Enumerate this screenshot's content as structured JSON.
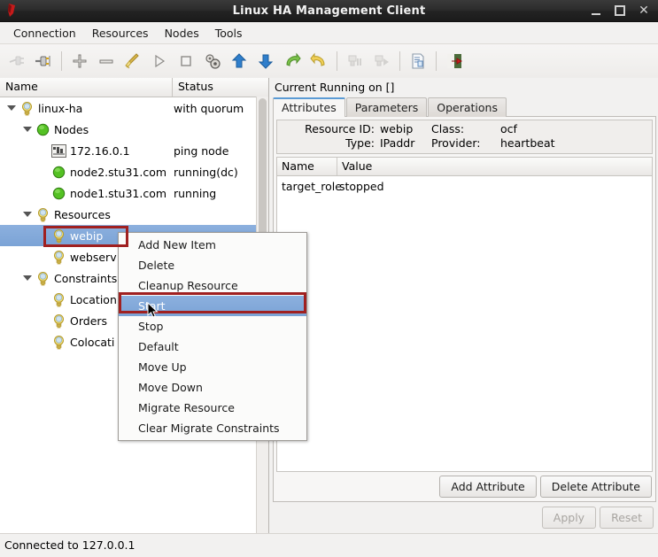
{
  "window": {
    "title": "Linux HA Management Client",
    "app_icon": "app-logo-icon",
    "minimize": "–",
    "maximize": "□",
    "close": "✕"
  },
  "menubar": {
    "items": [
      {
        "label": "Connection"
      },
      {
        "label": "Resources"
      },
      {
        "label": "Nodes"
      },
      {
        "label": "Tools"
      }
    ]
  },
  "toolbar": {
    "items": [
      {
        "name": "connect-icon",
        "enabled": false
      },
      {
        "name": "disconnect-icon",
        "enabled": true
      },
      {
        "name": "add-icon",
        "enabled": true
      },
      {
        "name": "remove-icon",
        "enabled": true
      },
      {
        "name": "cleanup-broom-icon",
        "enabled": true
      },
      {
        "name": "start-play-icon",
        "enabled": true
      },
      {
        "name": "stop-square-icon",
        "enabled": true
      },
      {
        "name": "default-gears-icon",
        "enabled": true
      },
      {
        "name": "move-up-arrow-icon",
        "enabled": true
      },
      {
        "name": "move-down-arrow-icon",
        "enabled": true
      },
      {
        "name": "migrate-resource-icon",
        "enabled": true
      },
      {
        "name": "clear-migrate-constraints-icon",
        "enabled": true
      },
      {
        "name": "standby-node-icon",
        "enabled": false
      },
      {
        "name": "activate-node-icon",
        "enabled": false
      },
      {
        "name": "cib-document-icon",
        "enabled": true
      },
      {
        "name": "exit-icon",
        "enabled": true
      }
    ]
  },
  "tree": {
    "columns": {
      "name": "Name",
      "status": "Status"
    },
    "rows": [
      {
        "label": "linux-ha",
        "status": "with quorum",
        "indent": 0,
        "icon": "bulb-icon",
        "twisty": "expanded",
        "selected": false
      },
      {
        "label": "Nodes",
        "status": "",
        "indent": 1,
        "icon": "green-circle-icon",
        "twisty": "expanded",
        "selected": false
      },
      {
        "label": "172.16.0.1",
        "status": "ping node",
        "indent": 2,
        "icon": "ping-node-icon",
        "twisty": "none",
        "selected": false
      },
      {
        "label": "node2.stu31.com",
        "status": "running(dc)",
        "indent": 2,
        "icon": "green-circle-icon",
        "twisty": "none",
        "selected": false
      },
      {
        "label": "node1.stu31.com",
        "status": "running",
        "indent": 2,
        "icon": "green-circle-icon",
        "twisty": "none",
        "selected": false
      },
      {
        "label": "Resources",
        "status": "",
        "indent": 1,
        "icon": "bulb-icon",
        "twisty": "expanded",
        "selected": false
      },
      {
        "label": "webip",
        "status": "",
        "indent": 2,
        "icon": "bulb-icon",
        "twisty": "none",
        "selected": true
      },
      {
        "label": "webserv",
        "status": "",
        "indent": 2,
        "icon": "bulb-icon",
        "twisty": "none",
        "selected": false
      },
      {
        "label": "Constraints",
        "status": "",
        "indent": 1,
        "icon": "bulb-icon",
        "twisty": "expanded",
        "selected": false
      },
      {
        "label": "Location",
        "status": "",
        "indent": 2,
        "icon": "bulb-icon",
        "twisty": "none",
        "selected": false
      },
      {
        "label": "Orders",
        "status": "",
        "indent": 2,
        "icon": "bulb-icon",
        "twisty": "none",
        "selected": false
      },
      {
        "label": "Colocati",
        "status": "",
        "indent": 2,
        "icon": "bulb-icon",
        "twisty": "none",
        "selected": false
      }
    ]
  },
  "context_menu": {
    "items": [
      {
        "label": "Add New Item",
        "highlighted": false
      },
      {
        "label": "Delete",
        "highlighted": false
      },
      {
        "label": "Cleanup Resource",
        "highlighted": false
      },
      {
        "label": "Start",
        "highlighted": true
      },
      {
        "label": "Stop",
        "highlighted": false
      },
      {
        "label": "Default",
        "highlighted": false
      },
      {
        "label": "Move Up",
        "highlighted": false
      },
      {
        "label": "Move Down",
        "highlighted": false
      },
      {
        "label": "Migrate Resource",
        "highlighted": false
      },
      {
        "label": "Clear Migrate Constraints",
        "highlighted": false
      }
    ]
  },
  "right_panel": {
    "running_label": "Current Running on []",
    "tabs": [
      {
        "label": "Attributes",
        "active": true
      },
      {
        "label": "Parameters",
        "active": false
      },
      {
        "label": "Operations",
        "active": false
      }
    ],
    "resource_info": {
      "resource_id_label": "Resource ID:",
      "resource_id_value": "webip",
      "class_label": "Class:",
      "class_value": "ocf",
      "type_label": "Type:",
      "type_value": "IPaddr",
      "provider_label": "Provider:",
      "provider_value": "heartbeat"
    },
    "attributes_table": {
      "columns": [
        "Name",
        "Value"
      ],
      "rows": [
        {
          "name": "target_role",
          "value": "stopped"
        }
      ]
    },
    "buttons": {
      "add_attribute": "Add Attribute",
      "delete_attribute": "Delete Attribute",
      "apply": "Apply",
      "reset": "Reset"
    }
  },
  "statusbar": {
    "text": "Connected to 127.0.0.1"
  },
  "colors": {
    "selection_blue": "#7ba3d6",
    "annotation_red": "#a02020",
    "tab_accent": "#5b9bd5",
    "node_green": "#5cc22e",
    "titlebar_dark": "#232323"
  }
}
